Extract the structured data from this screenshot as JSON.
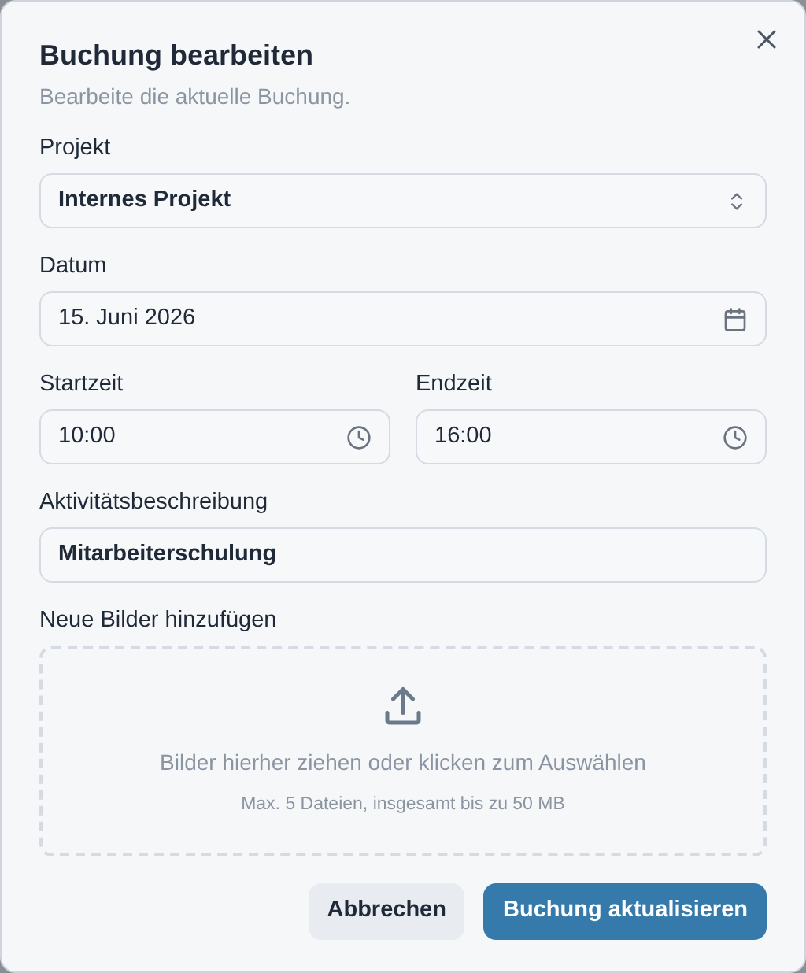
{
  "dialog": {
    "title": "Buchung bearbeiten",
    "description": "Bearbeite die aktuelle Buchung."
  },
  "fields": [
    {
      "kind": "select",
      "label": "Projekt",
      "value": "Internes Projekt"
    },
    {
      "kind": "date",
      "label": "Datum",
      "value": "15. Juni 2026"
    },
    {
      "kind": "times",
      "items": [
        {
          "label": "Startzeit",
          "value": "10:00"
        },
        {
          "label": "Endzeit",
          "value": "16:00"
        }
      ]
    },
    {
      "kind": "text",
      "label": "Aktivitätsbeschreibung",
      "value": "Mitarbeiterschulung"
    },
    {
      "kind": "upload",
      "label": "Neue Bilder hinzufügen",
      "hint": "Bilder hierher ziehen oder klicken zum Auswählen",
      "limit": "Max. 5 Dateien, insgesamt bis zu 50 MB"
    }
  ],
  "buttons": [
    {
      "label": "Abbrechen",
      "kind": "secondary"
    },
    {
      "label": "Buchung aktualisieren",
      "kind": "primary"
    }
  ]
}
